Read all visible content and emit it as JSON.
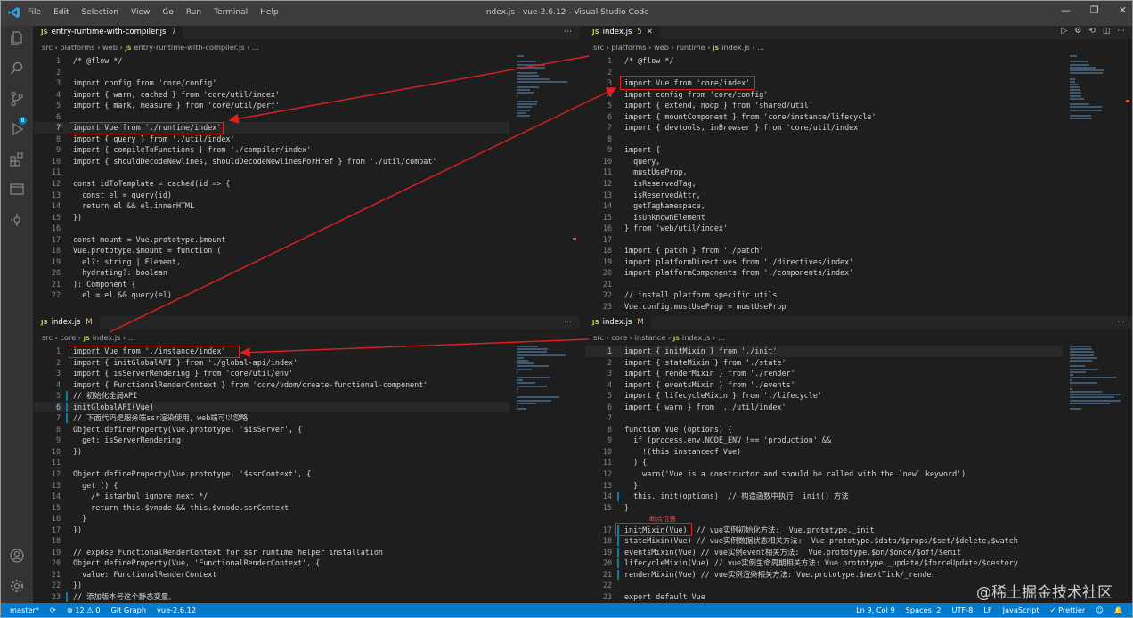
{
  "window": {
    "title": "index.js - vue-2.6.12 - Visual Studio Code",
    "menu": [
      "File",
      "Edit",
      "Selection",
      "View",
      "Go",
      "Run",
      "Terminal",
      "Help"
    ],
    "controls": [
      "—",
      "❐",
      "✕"
    ]
  },
  "activity": {
    "items": [
      "explorer-icon",
      "search-icon",
      "source-control-icon",
      "run-debug-icon",
      "extensions-icon",
      "remote-explorer-icon",
      "git-graph-icon"
    ],
    "scm_badge": "8",
    "bottom": [
      "account-icon",
      "settings-gear-icon"
    ]
  },
  "panes": [
    {
      "tab": {
        "icon": "JS",
        "label": "entry-runtime-with-compiler.js",
        "suffix": "7"
      },
      "more": "···",
      "crumbs": "src › platforms › web › ",
      "crumb_file": "entry-runtime-with-compiler.js",
      "crumb_tail": " › ...",
      "lines": [
        {
          "n": "1",
          "t": "/* @flow */"
        },
        {
          "n": "2",
          "t": ""
        },
        {
          "n": "3",
          "t": "import config from 'core/config'"
        },
        {
          "n": "4",
          "t": "import { warn, cached } from 'core/util/index'"
        },
        {
          "n": "5",
          "t": "import { mark, measure } from 'core/util/perf'"
        },
        {
          "n": "6",
          "t": ""
        },
        {
          "n": "7",
          "t": "import Vue from './runtime/index'",
          "cur": true
        },
        {
          "n": "8",
          "t": "import { query } from './util/index'"
        },
        {
          "n": "9",
          "t": "import { compileToFunctions } from './compiler/index'"
        },
        {
          "n": "10",
          "t": "import { shouldDecodeNewlines, shouldDecodeNewlinesForHref } from './util/compat'"
        },
        {
          "n": "11",
          "t": ""
        },
        {
          "n": "12",
          "t": "const idToTemplate = cached(id => {"
        },
        {
          "n": "13",
          "t": "  const el = query(id)"
        },
        {
          "n": "14",
          "t": "  return el && el.innerHTML"
        },
        {
          "n": "15",
          "t": "})"
        },
        {
          "n": "16",
          "t": ""
        },
        {
          "n": "17",
          "t": "const mount = Vue.prototype.$mount"
        },
        {
          "n": "18",
          "t": "Vue.prototype.$mount = function ("
        },
        {
          "n": "19",
          "t": "  el?: string | Element,"
        },
        {
          "n": "20",
          "t": "  hydrating?: boolean"
        },
        {
          "n": "21",
          "t": "): Component {"
        },
        {
          "n": "22",
          "t": "  el = el && query(el)"
        }
      ]
    },
    {
      "tab": {
        "icon": "JS",
        "label": "index.js",
        "suffix": "5"
      },
      "actions": [
        "▷",
        "⚙",
        "⟲",
        "◫",
        "···"
      ],
      "crumbs": "src › platforms › web › runtime › ",
      "crumb_file": "index.js",
      "crumb_tail": " › ...",
      "lines": [
        {
          "n": "1",
          "t": "/* @flow */"
        },
        {
          "n": "2",
          "t": ""
        },
        {
          "n": "3",
          "t": "import Vue from 'core/index'"
        },
        {
          "n": "4",
          "t": "import config from 'core/config'"
        },
        {
          "n": "5",
          "t": "import { extend, noop } from 'shared/util'"
        },
        {
          "n": "6",
          "t": "import { mountComponent } from 'core/instance/lifecycle'"
        },
        {
          "n": "7",
          "t": "import { devtools, inBrowser } from 'core/util/index'"
        },
        {
          "n": "8",
          "t": ""
        },
        {
          "n": "9",
          "t": "import {"
        },
        {
          "n": "10",
          "t": "  query,"
        },
        {
          "n": "11",
          "t": "  mustUseProp,"
        },
        {
          "n": "12",
          "t": "  isReservedTag,"
        },
        {
          "n": "13",
          "t": "  isReservedAttr,"
        },
        {
          "n": "14",
          "t": "  getTagNamespace,"
        },
        {
          "n": "15",
          "t": "  isUnknownElement"
        },
        {
          "n": "16",
          "t": "} from 'web/util/index'"
        },
        {
          "n": "17",
          "t": ""
        },
        {
          "n": "18",
          "t": "import { patch } from './patch'"
        },
        {
          "n": "19",
          "t": "import platformDirectives from './directives/index'"
        },
        {
          "n": "20",
          "t": "import platformComponents from './components/index'"
        },
        {
          "n": "21",
          "t": ""
        },
        {
          "n": "22",
          "t": "// install platform specific utils"
        },
        {
          "n": "23",
          "t": "Vue.config.mustUseProp = mustUseProp"
        }
      ]
    },
    {
      "tab": {
        "icon": "JS",
        "label": "index.js",
        "suffix": "M"
      },
      "more": "···",
      "crumbs": "src › core › ",
      "crumb_file": "index.js",
      "crumb_tail": " › ...",
      "lines": [
        {
          "n": "1",
          "t": "import Vue from './instance/index'"
        },
        {
          "n": "2",
          "t": "import { initGlobalAPI } from './global-api/index'"
        },
        {
          "n": "3",
          "t": "import { isServerRendering } from 'core/util/env'"
        },
        {
          "n": "4",
          "t": "import { FunctionalRenderContext } from 'core/vdom/create-functional-component'"
        },
        {
          "n": "5",
          "t": "// 初始化全局API",
          "mod": true
        },
        {
          "n": "6",
          "t": "initGlobalAPI(Vue)",
          "cur": true,
          "mod": true
        },
        {
          "n": "7",
          "t": "// 下面代码是服务端ssr渲染使用，web端可以忽略",
          "mod": true
        },
        {
          "n": "8",
          "t": "Object.defineProperty(Vue.prototype, '$isServer', {"
        },
        {
          "n": "9",
          "t": "  get: isServerRendering"
        },
        {
          "n": "10",
          "t": "})"
        },
        {
          "n": "11",
          "t": ""
        },
        {
          "n": "12",
          "t": "Object.defineProperty(Vue.prototype, '$ssrContext', {"
        },
        {
          "n": "13",
          "t": "  get () {"
        },
        {
          "n": "14",
          "t": "    /* istanbul ignore next */"
        },
        {
          "n": "15",
          "t": "    return this.$vnode && this.$vnode.ssrContext"
        },
        {
          "n": "16",
          "t": "  }"
        },
        {
          "n": "17",
          "t": "})"
        },
        {
          "n": "18",
          "t": ""
        },
        {
          "n": "19",
          "t": "// expose FunctionalRenderContext for ssr runtime helper installation"
        },
        {
          "n": "20",
          "t": "Object.defineProperty(Vue, 'FunctionalRenderContext', {"
        },
        {
          "n": "21",
          "t": "  value: FunctionalRenderContext"
        },
        {
          "n": "22",
          "t": "})"
        },
        {
          "n": "23",
          "t": "// 添加版本号这个静态变量。",
          "mod": true
        }
      ]
    },
    {
      "tab": {
        "icon": "JS",
        "label": "index.js",
        "suffix": "M"
      },
      "more": "···",
      "crumbs": "src › core › instance › ",
      "crumb_file": "index.js",
      "crumb_tail": " › ...",
      "lines": [
        {
          "n": "1",
          "t": "import { initMixin } from './init'",
          "cur": true
        },
        {
          "n": "2",
          "t": "import { stateMixin } from './state'"
        },
        {
          "n": "3",
          "t": "import { renderMixin } from './render'"
        },
        {
          "n": "4",
          "t": "import { eventsMixin } from './events'"
        },
        {
          "n": "5",
          "t": "import { lifecycleMixin } from './lifecycle'"
        },
        {
          "n": "6",
          "t": "import { warn } from '../util/index'"
        },
        {
          "n": "7",
          "t": ""
        },
        {
          "n": "8",
          "t": "function Vue (options) {"
        },
        {
          "n": "9",
          "t": "  if (process.env.NODE_ENV !== 'production' &&"
        },
        {
          "n": "10",
          "t": "    !(this instanceof Vue)"
        },
        {
          "n": "11",
          "t": "  ) {"
        },
        {
          "n": "12",
          "t": "    warn('Vue is a constructor and should be called with the `new` keyword')"
        },
        {
          "n": "13",
          "t": "  }"
        },
        {
          "n": "14",
          "t": "  this._init(options)  // 构造函数中执行 _init() 方法",
          "mod": true
        },
        {
          "n": "15",
          "t": "}"
        },
        {
          "n": "",
          "t": "断点位置",
          "ann": true
        },
        {
          "n": "17",
          "t": "initMixin(Vue)  // vue实例初始化方法:  Vue.prototype._init",
          "mod": true
        },
        {
          "n": "18",
          "t": "stateMixin(Vue) // vue实例数据状态相关方法:  Vue.prototype.$data/$props/$set/$delete,$watch",
          "mod": true
        },
        {
          "n": "19",
          "t": "eventsMixin(Vue) // vue实例event相关方法:  Vue.prototype.$on/$once/$off/$emit",
          "mod": true
        },
        {
          "n": "20",
          "t": "lifecycleMixin(Vue) // vue实例生命周期相关方法: Vue.prototype._update/$forceUpdate/$destory",
          "mod": true
        },
        {
          "n": "21",
          "t": "renderMixin(Vue) // vue实例渲染相关方法: Vue.prototype.$nextTick/_render",
          "mod": true
        },
        {
          "n": "22",
          "t": ""
        },
        {
          "n": "23",
          "t": "export default Vue"
        }
      ]
    }
  ],
  "status": {
    "branch": "master*",
    "sync": "⟳",
    "problems": "⊗ 12 ⚠ 0",
    "git_graph": "Git Graph",
    "folder": "vue-2.6.12",
    "position": "Ln 9, Col 9",
    "spaces": "Spaces: 2",
    "encoding": "UTF-8",
    "eol": "LF",
    "language": "JavaScript",
    "prettier": "✓ Prettier",
    "feedback": "☺",
    "bell": "🔔"
  },
  "watermark": "@稀土掘金技术社区",
  "colors": {
    "highlight_box": "#e02020",
    "arrow": "#e02020",
    "statusbar": "#007acc"
  }
}
